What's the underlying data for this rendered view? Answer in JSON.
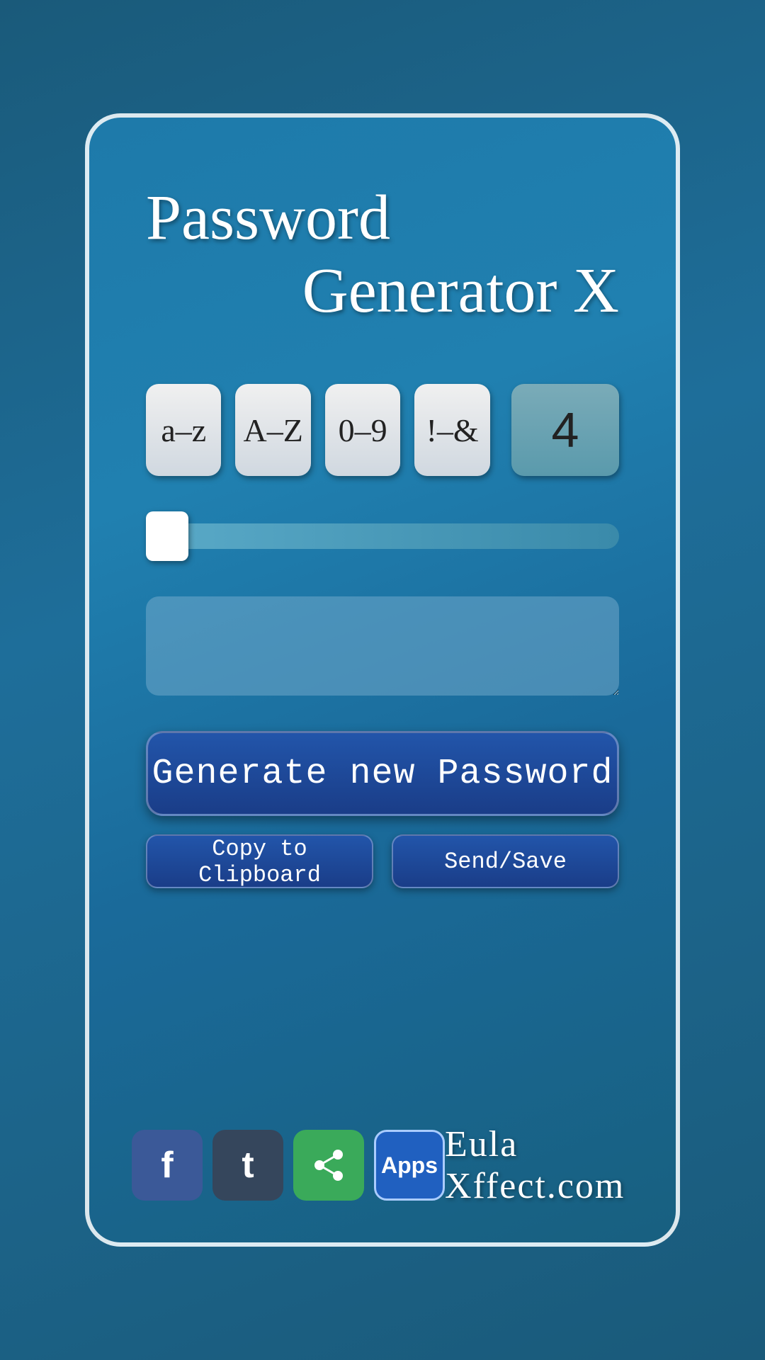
{
  "app": {
    "title_line1": "Password",
    "title_line2": "Generator X",
    "brand": "Eula Xffect.com"
  },
  "charset_buttons": [
    {
      "label": "a–z"
    },
    {
      "label": "A–Z"
    },
    {
      "label": "0–9"
    },
    {
      "label": "!–&"
    }
  ],
  "count_button": {
    "value": "4"
  },
  "password_field": {
    "placeholder": "",
    "value": ""
  },
  "buttons": {
    "generate": "Generate new Password",
    "copy": "Copy to Clipboard",
    "send_save": "Send/Save"
  },
  "social": {
    "facebook": "f",
    "tumblr": "t",
    "share": "◁",
    "apps": "Apps"
  }
}
